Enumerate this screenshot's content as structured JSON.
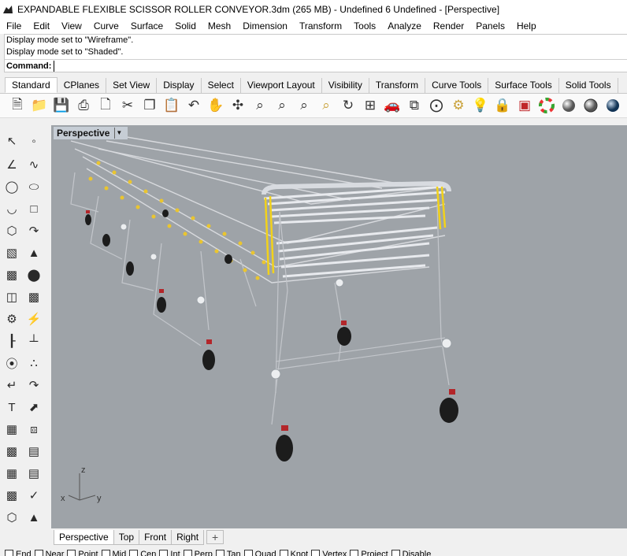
{
  "window": {
    "title": "EXPANDABLE FLEXIBLE SCISSOR ROLLER CONVEYOR.3dm (265 MB) - Undefined 6 Undefined - [Perspective]"
  },
  "menu": [
    "File",
    "Edit",
    "View",
    "Curve",
    "Surface",
    "Solid",
    "Mesh",
    "Dimension",
    "Transform",
    "Tools",
    "Analyze",
    "Render",
    "Panels",
    "Help"
  ],
  "command": {
    "history": [
      "Display mode set to \"Wireframe\".",
      "Display mode set to \"Shaded\"."
    ],
    "prompt": "Command:",
    "value": ""
  },
  "toolbar_tabs": [
    "Standard",
    "CPlanes",
    "Set View",
    "Display",
    "Select",
    "Viewport Layout",
    "Visibility",
    "Transform",
    "Curve Tools",
    "Surface Tools",
    "Solid Tools"
  ],
  "toolbar_icons": [
    "new-icon",
    "open-icon",
    "save-icon",
    "print-icon",
    "import-icon",
    "cut-icon",
    "copy-icon",
    "paste-icon",
    "undo-icon",
    "pan-icon",
    "rotate-view-icon",
    "zoom-icon",
    "zoom-window-icon",
    "zoom-extents-icon",
    "zoom-selected-icon",
    "rotate-icon",
    "four-viewports-icon",
    "car-icon",
    "ortho-icon",
    "osnap-icon",
    "properties-icon",
    "light-icon",
    "lock-icon",
    "layer-icon",
    "color-wheel-icon",
    "shaded-sphere-icon",
    "render-sphere-icon",
    "material-sphere-icon"
  ],
  "viewport": {
    "label": "Perspective",
    "axis_x": "x",
    "axis_y": "y",
    "axis_z": "z"
  },
  "viewport_tabs": [
    "Perspective",
    "Top",
    "Front",
    "Right"
  ],
  "viewport_tab_add": "+",
  "osnaps": [
    "End",
    "Near",
    "Point",
    "Mid",
    "Cen",
    "Int",
    "Perp",
    "Tan",
    "Quad",
    "Knot",
    "Vertex",
    "Project",
    "Disable"
  ]
}
